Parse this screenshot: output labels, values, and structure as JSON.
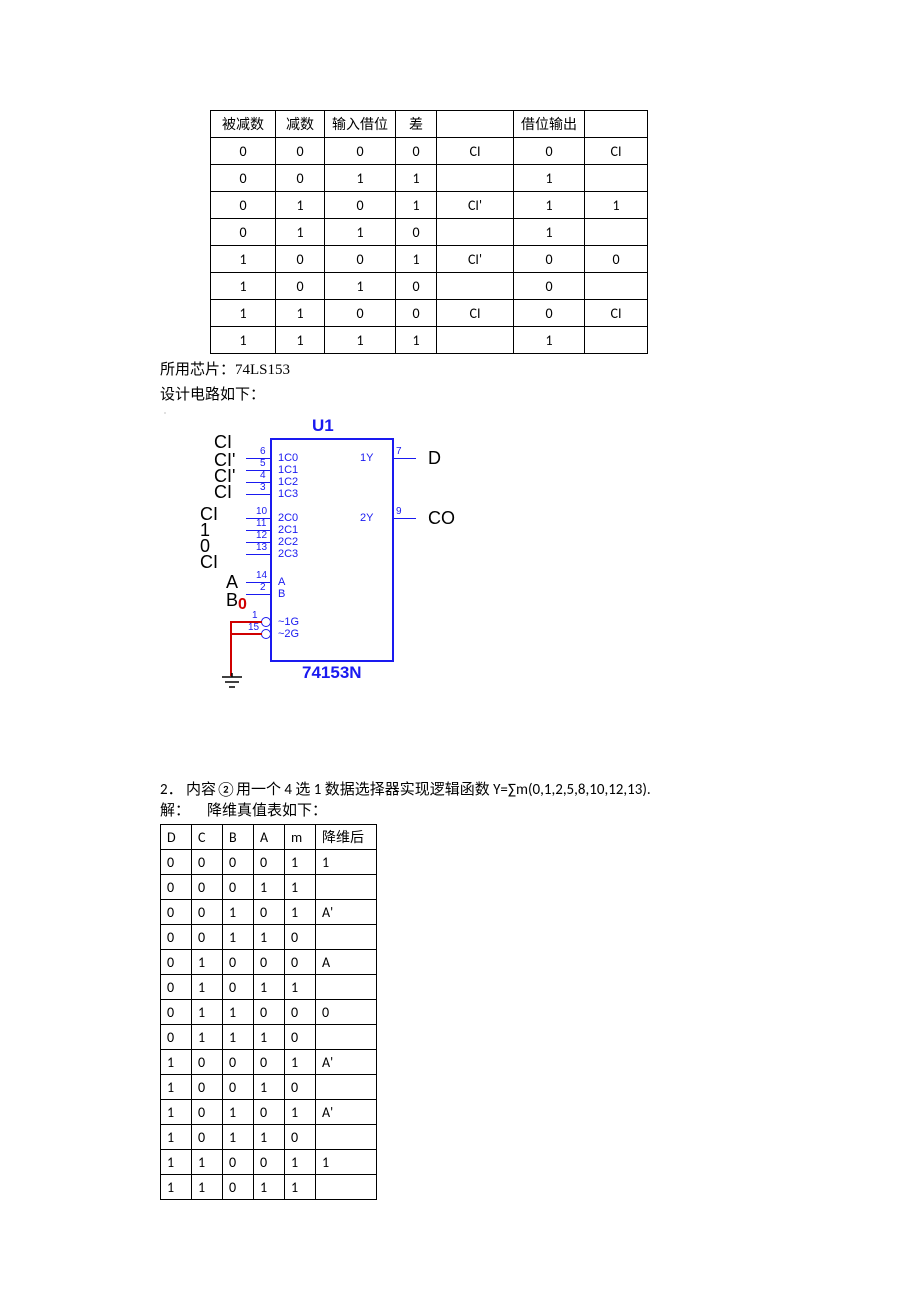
{
  "table1": {
    "headers": [
      "被减数",
      "减数",
      "输入借位",
      "差",
      "",
      "借位输出",
      ""
    ],
    "rows": [
      [
        "0",
        "0",
        "0",
        "0",
        "CI",
        "0",
        "CI"
      ],
      [
        "0",
        "0",
        "1",
        "1",
        "",
        "1",
        ""
      ],
      [
        "0",
        "1",
        "0",
        "1",
        "CI'",
        "1",
        "1"
      ],
      [
        "0",
        "1",
        "1",
        "0",
        "",
        "1",
        ""
      ],
      [
        "1",
        "0",
        "0",
        "1",
        "CI'",
        "0",
        "0"
      ],
      [
        "1",
        "0",
        "1",
        "0",
        "",
        "0",
        ""
      ],
      [
        "1",
        "1",
        "0",
        "0",
        "CI",
        "0",
        "CI"
      ],
      [
        "1",
        "1",
        "1",
        "1",
        "",
        "1",
        ""
      ]
    ]
  },
  "para1": "所用芯片：74LS153",
  "para2": "设计电路如下：",
  "circuit": {
    "u1": "U1",
    "chip": "74153N",
    "left_labels": {
      "l1": "CI",
      "l2": "CI'",
      "l3": "CI'",
      "l4": "CI",
      "l5": "CI",
      "l6": "1",
      "l7": "0",
      "l8": "CI",
      "l9": "A",
      "l10": "B"
    },
    "right_labels": {
      "d": "D",
      "co": "CO"
    },
    "zero": "0",
    "pins_left": {
      "p1c0": "1C0",
      "p1c1": "1C1",
      "p1c2": "1C2",
      "p1c3": "1C3",
      "p2c0": "2C0",
      "p2c1": "2C1",
      "p2c2": "2C2",
      "p2c3": "2C3",
      "pa": "A",
      "pb": "B",
      "pg1": "~1G",
      "pg2": "~2G"
    },
    "pins_right": {
      "y1": "1Y",
      "y2": "2Y"
    },
    "pinnums": {
      "n6": "6",
      "n5": "5",
      "n4": "4",
      "n3": "3",
      "n10": "10",
      "n11": "11",
      "n12": "12",
      "n13": "13",
      "n14": "14",
      "n2": "2",
      "n1": "1",
      "n15": "15",
      "n7": "7",
      "n9": "9"
    }
  },
  "q2_num": "2．",
  "q2_text_a": "内容②用一个 4 选 1 数据选择器实现逻辑函数 Y=∑m(0,1,2,5,8,10,12,13).",
  "q2_ans_prefix": "解：",
  "q2_ans_text": "降维真值表如下：",
  "table2": {
    "headers": [
      "D",
      "C",
      "B",
      "A",
      "m",
      "降维后"
    ],
    "rows": [
      [
        "0",
        "0",
        "0",
        "0",
        "1",
        "1"
      ],
      [
        "0",
        "0",
        "0",
        "1",
        "1",
        ""
      ],
      [
        "0",
        "0",
        "1",
        "0",
        "1",
        "A'"
      ],
      [
        "0",
        "0",
        "1",
        "1",
        "0",
        ""
      ],
      [
        "0",
        "1",
        "0",
        "0",
        "0",
        "A"
      ],
      [
        "0",
        "1",
        "0",
        "1",
        "1",
        ""
      ],
      [
        "0",
        "1",
        "1",
        "0",
        "0",
        "0"
      ],
      [
        "0",
        "1",
        "1",
        "1",
        "0",
        ""
      ],
      [
        "1",
        "0",
        "0",
        "0",
        "1",
        "A'"
      ],
      [
        "1",
        "0",
        "0",
        "1",
        "0",
        ""
      ],
      [
        "1",
        "0",
        "1",
        "0",
        "1",
        "A'"
      ],
      [
        "1",
        "0",
        "1",
        "1",
        "0",
        ""
      ],
      [
        "1",
        "1",
        "0",
        "0",
        "1",
        "1"
      ],
      [
        "1",
        "1",
        "0",
        "1",
        "1",
        ""
      ]
    ]
  }
}
